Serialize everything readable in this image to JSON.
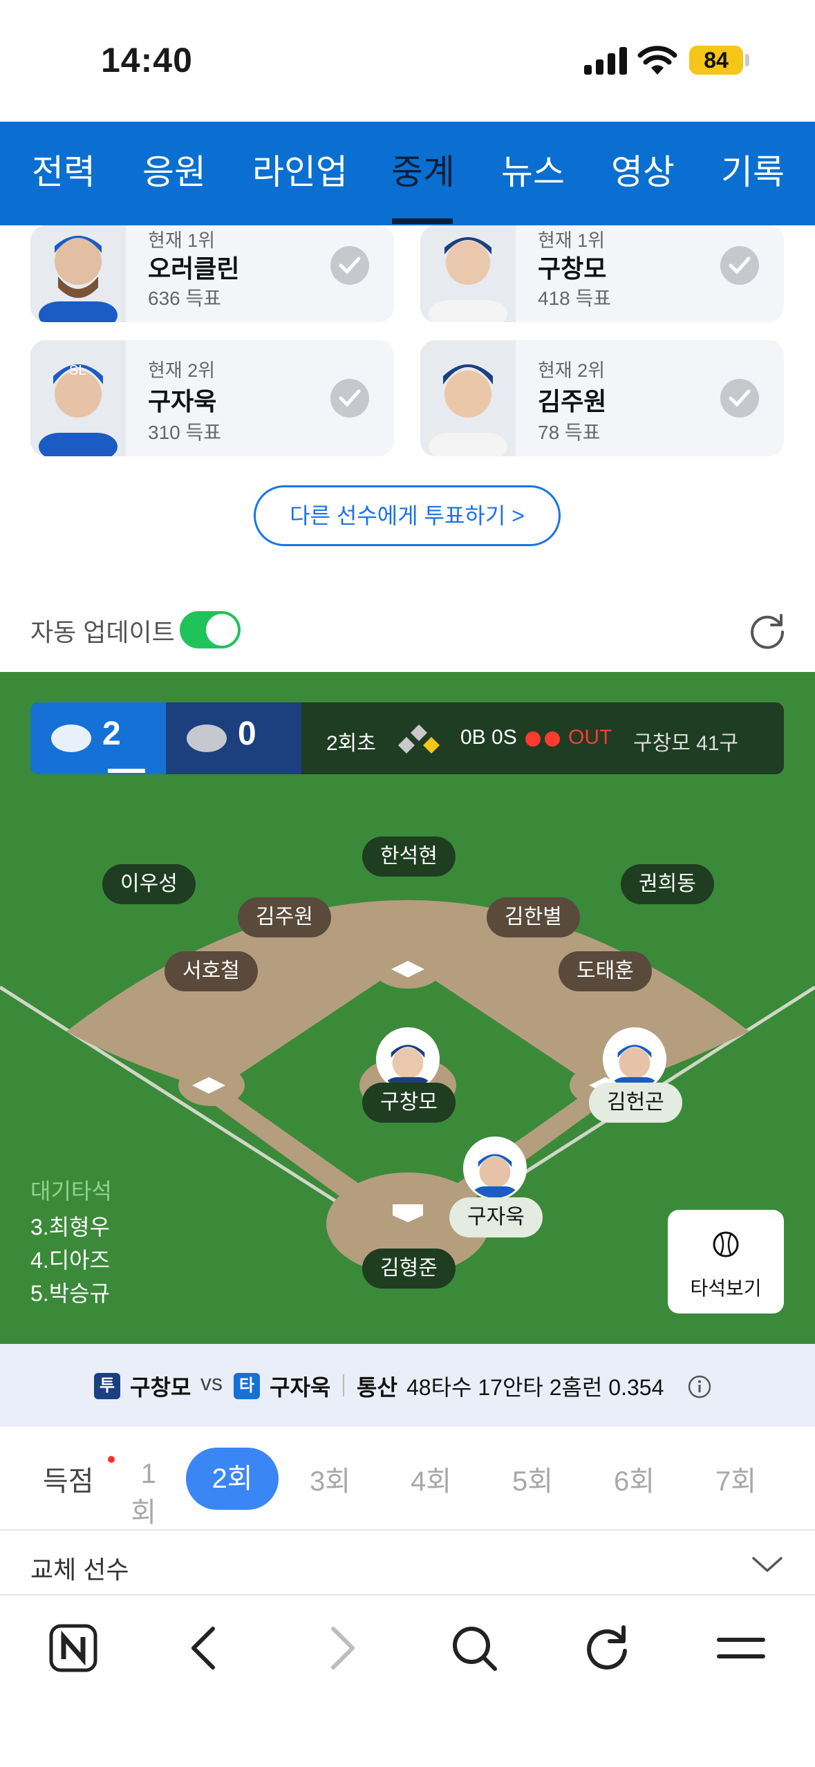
{
  "status_bar": {
    "time": "14:40",
    "battery": "84"
  },
  "tabs": [
    "전력",
    "응원",
    "라인업",
    "중계",
    "뉴스",
    "영상",
    "기록"
  ],
  "active_tab": "중계",
  "vote_cards": [
    {
      "rank": "현재 1위",
      "name": "오러클린",
      "votes": "636 득표"
    },
    {
      "rank": "현재 1위",
      "name": "구창모",
      "votes": "418 득표"
    },
    {
      "rank": "현재 2위",
      "name": "구자욱",
      "votes": "310 득표"
    },
    {
      "rank": "현재 2위",
      "name": "김주원",
      "votes": "78 득표"
    }
  ],
  "vote_more_label": "다른 선수에게 투표하기 >",
  "auto_update_label": "자동 업데이트",
  "scoreboard": {
    "home_score": "2",
    "away_score": "0",
    "inning": "2회초",
    "count": "0B 0S",
    "out_label": "OUT",
    "pitcher": "구창모 41구"
  },
  "field_players": {
    "cf": "한석현",
    "lf": "이우성",
    "rf": "권희동",
    "ss": "김주원",
    "2b": "김한별",
    "3b": "서호철",
    "1b": "도태훈",
    "pitcher": "구창모",
    "runner_first": "김헌곤",
    "batter": "구자욱",
    "catcher": "김형준"
  },
  "lineup": {
    "title": "대기타석",
    "items": [
      "3.최형우",
      "4.디아즈",
      "5.박승규"
    ]
  },
  "atbat_button": "타석보기",
  "matchup": {
    "pitcher_badge": "투",
    "pitcher": "구창모",
    "vs": "vs",
    "batter_badge": "타",
    "batter": "구자욱",
    "career_label": "통산",
    "career_stats": "48타수 17안타 2홈런 0.354"
  },
  "innings": [
    "득점",
    "1회",
    "2회",
    "3회",
    "4회",
    "5회",
    "6회",
    "7회"
  ],
  "active_inning": "2회",
  "sub_label": "교체 선수",
  "colors": {
    "brand_blue": "#0a6fd0",
    "field_green": "#3b8a3a",
    "infield_dirt": "#b49e7e",
    "accent_pill": "#3a86f4"
  }
}
